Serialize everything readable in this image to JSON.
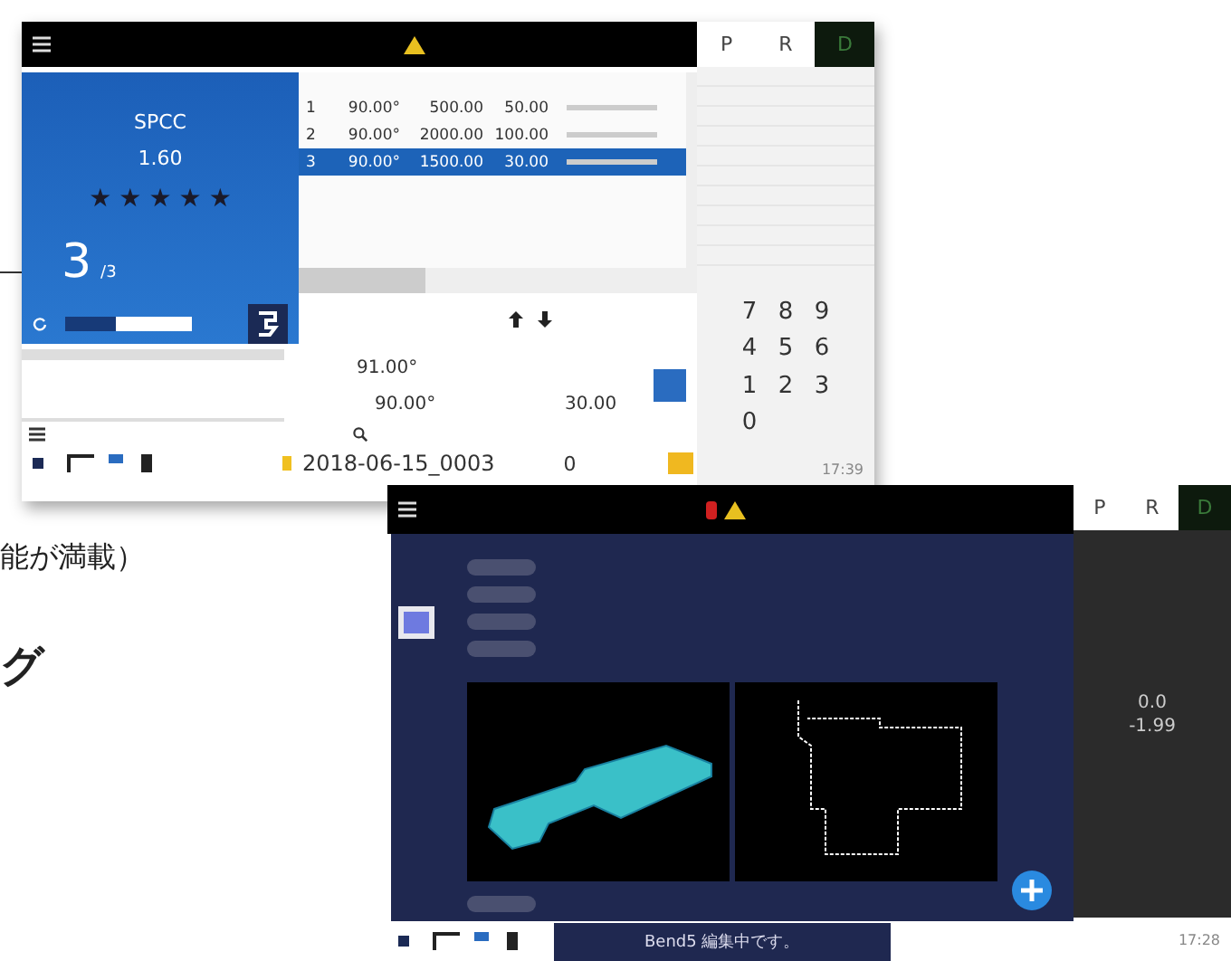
{
  "page_text": [
    {
      "kind": "body",
      "text": "能が満載）"
    },
    {
      "kind": "heading",
      "text": "グ"
    }
  ],
  "screen_1": {
    "tabs": [
      {
        "label": "P",
        "selected": false
      },
      {
        "label": "R",
        "selected": false
      },
      {
        "label": "D",
        "selected": true
      }
    ],
    "material": {
      "name": "SPCC",
      "thickness": "1.60",
      "stars": 5,
      "count": "3",
      "total": "/3"
    },
    "bends": [
      {
        "index": "1",
        "angle": "90.00°",
        "length": "500.00",
        "flange": "50.00",
        "selected": false
      },
      {
        "index": "2",
        "angle": "90.00°",
        "length": "2000.00",
        "flange": "100.00",
        "selected": false
      },
      {
        "index": "3",
        "angle": "90.00°",
        "length": "1500.00",
        "flange": "30.00",
        "selected": true
      }
    ],
    "readings": [
      "91.00°",
      "90.00°",
      "30.00"
    ],
    "file_name": "2018-06-15_0003",
    "counter": "0",
    "keypad": [
      "7",
      "8",
      "9",
      "4",
      "5",
      "6",
      "1",
      "2",
      "3",
      "0"
    ],
    "clock": "17:39"
  },
  "screen_2": {
    "tabs": [
      {
        "label": "P",
        "selected": false
      },
      {
        "label": "R",
        "selected": false
      },
      {
        "label": "D",
        "selected": true
      }
    ],
    "readings": [
      "0.0",
      "-1.99"
    ],
    "status_message": "Bend5 編集中です。",
    "clock": "17:28"
  }
}
